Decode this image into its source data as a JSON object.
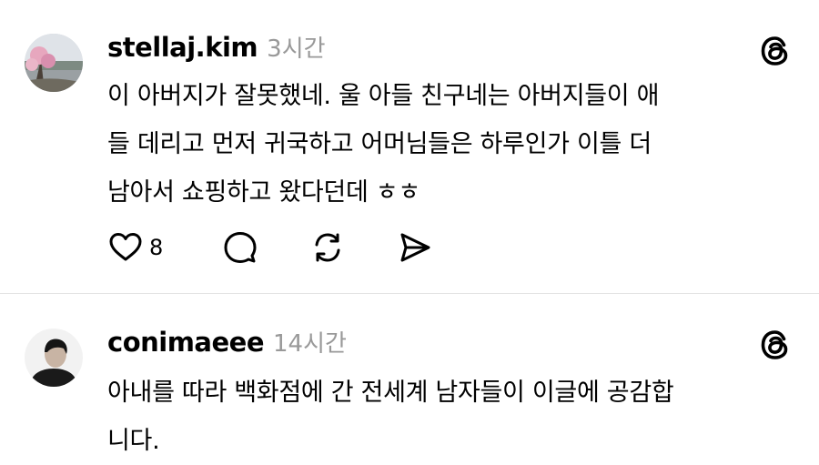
{
  "posts": [
    {
      "username": "stellaj.kim",
      "time": "3시간",
      "lines": [
        "이 아버지가 잘못했네. 울 아들 친구네는 아버지들이 애",
        "들 데리고 먼저 귀국하고 어머님들은 하루인가 이틀 더",
        "남아서 쇼핑하고 왔다던데 ㅎㅎ"
      ],
      "likes": "8",
      "icons": [
        "heart-icon",
        "comment-icon",
        "repost-icon",
        "share-icon",
        "threads-logo-icon"
      ]
    },
    {
      "username": "conimaeee",
      "time": "14시간",
      "lines": [
        "아내를 따라 백화점에 간 전세계 남자들이 이글에 공감합",
        "니다."
      ],
      "icons": [
        "threads-logo-icon"
      ]
    }
  ]
}
